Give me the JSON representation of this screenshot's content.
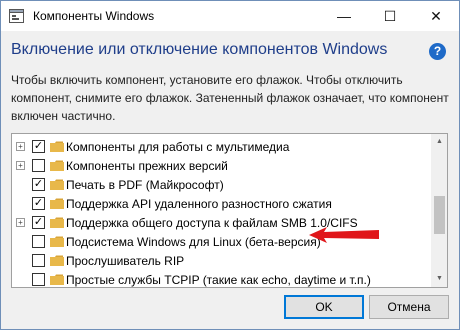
{
  "window": {
    "title": "Компоненты Windows",
    "controls": {
      "minimize": "—",
      "maximize": "☐",
      "close": "✕"
    }
  },
  "heading": "Включение или отключение компонентов Windows",
  "help": "?",
  "description": "Чтобы включить компонент, установите его флажок. Чтобы отключить компонент, снимите его флажок. Затененный флажок означает, что компонент включен частично.",
  "features": [
    {
      "label": "Компоненты для работы с мультимедиа",
      "expandable": true,
      "checked": true
    },
    {
      "label": "Компоненты прежних версий",
      "expandable": true,
      "checked": false
    },
    {
      "label": "Печать в PDF (Майкрософт)",
      "expandable": false,
      "checked": true
    },
    {
      "label": "Поддержка API удаленного разностного сжатия",
      "expandable": false,
      "checked": true
    },
    {
      "label": "Поддержка общего доступа к файлам SMB 1.0/CIFS",
      "expandable": true,
      "checked": true
    },
    {
      "label": "Подсистема Windows для Linux (бета-версия)",
      "expandable": false,
      "checked": false
    },
    {
      "label": "Прослушиватель RIP",
      "expandable": false,
      "checked": false
    },
    {
      "label": "Простые службы TCPIP (такие как echo, daytime и т.п.)",
      "expandable": false,
      "checked": false
    }
  ],
  "colors": {
    "heading": "#1f3e8a",
    "folder": "#e8b84a",
    "arrow": "#e0161a",
    "accent": "#0078d7"
  },
  "buttons": {
    "ok": "OK",
    "cancel": "Отмена"
  }
}
